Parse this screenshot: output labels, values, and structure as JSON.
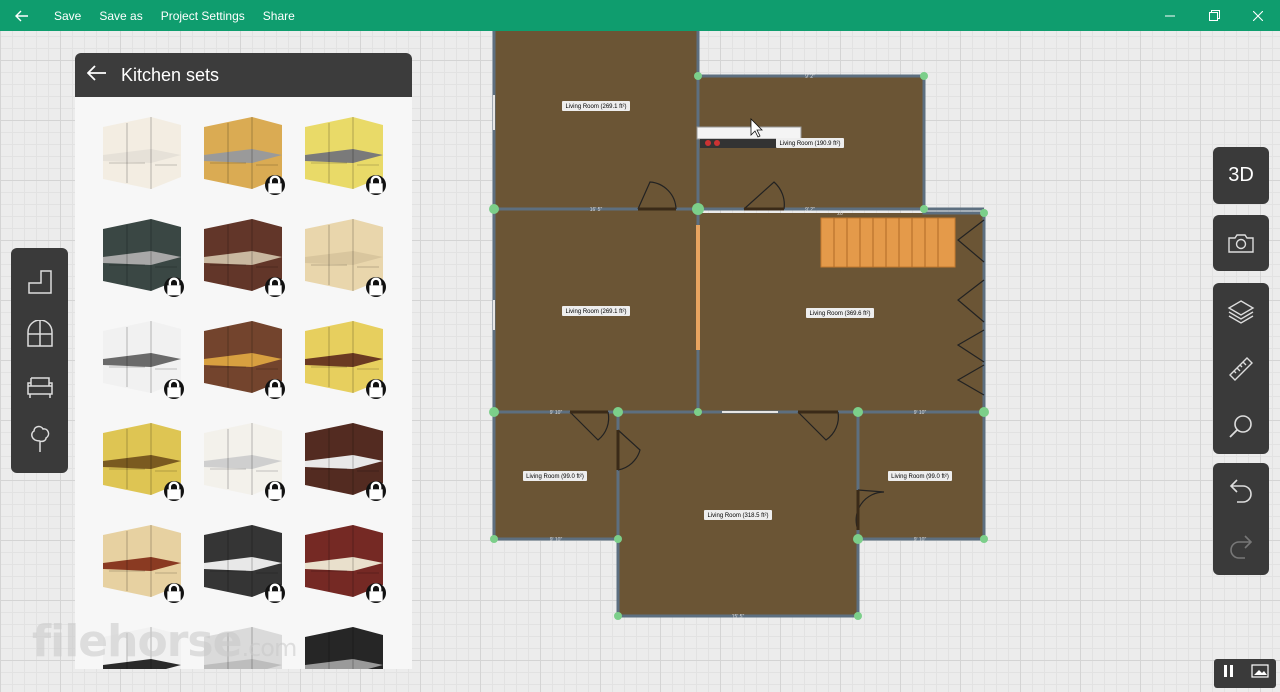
{
  "titlebar": {
    "menu": [
      "Save",
      "Save as",
      "Project Settings",
      "Share"
    ],
    "bg_color": "#0f9d6e",
    "icons": [
      "back-arrow-icon",
      "minimize-icon",
      "maximize-icon",
      "close-icon"
    ]
  },
  "catalog": {
    "title": "Kitchen sets",
    "items": [
      {
        "locked": false,
        "cabinet": "#f2ece0",
        "counter": "#e6e1d8"
      },
      {
        "locked": true,
        "cabinet": "#d8a64a",
        "counter": "#9a9a9a"
      },
      {
        "locked": true,
        "cabinet": "#e8d860",
        "counter": "#7a7a7a"
      },
      {
        "locked": true,
        "cabinet": "#2f3d3a",
        "counter": "#a8a8a8"
      },
      {
        "locked": true,
        "cabinet": "#5a2b1e",
        "counter": "#c9b8a0"
      },
      {
        "locked": true,
        "cabinet": "#e8d4a8",
        "counter": "#d9c69e"
      },
      {
        "locked": true,
        "cabinet": "#f0f0f0",
        "counter": "#6a6a6a"
      },
      {
        "locked": true,
        "cabinet": "#6b3a22",
        "counter": "#d8a040"
      },
      {
        "locked": true,
        "cabinet": "#e6cc55",
        "counter": "#6b3a22"
      },
      {
        "locked": true,
        "cabinet": "#dcc24a",
        "counter": "#7a5a20"
      },
      {
        "locked": true,
        "cabinet": "#f2f0ea",
        "counter": "#cfcfcf"
      },
      {
        "locked": true,
        "cabinet": "#4a2015",
        "counter": "#e8e8e8"
      },
      {
        "locked": true,
        "cabinet": "#e6cf9c",
        "counter": "#8a3a22"
      },
      {
        "locked": true,
        "cabinet": "#2a2a2a",
        "counter": "#e8e8e8"
      },
      {
        "locked": true,
        "cabinet": "#6e1e18",
        "counter": "#e9e0cc"
      },
      {
        "locked": false,
        "cabinet": "#f0f0f0",
        "counter": "#2a2a2a"
      },
      {
        "locked": false,
        "cabinet": "#d8d8d8",
        "counter": "#bdbdbd"
      },
      {
        "locked": false,
        "cabinet": "#1a1a1a",
        "counter": "#9a9a9a"
      }
    ]
  },
  "left_tools": [
    "wall-tool-icon",
    "window-tool-icon",
    "furniture-tool-icon",
    "plant-tool-icon"
  ],
  "right_toolbar": {
    "view_3d_label": "3D",
    "icons": [
      "camera-icon",
      "layers-icon",
      "ruler-icon",
      "search-icon",
      "undo-icon",
      "redo-icon"
    ]
  },
  "floorplan": {
    "room_color": "#6b5535",
    "wall_color": "#5d6f80",
    "node_color": "#7ccf8a",
    "rooms": [
      {
        "label": "Living Room (269.1 ft²)"
      },
      {
        "label": "Living Room (190.9 ft²)"
      },
      {
        "label": "Living Room (269.1 ft²)"
      },
      {
        "label": "Living Room (369.6 ft²)"
      },
      {
        "label": "Living Room (99.0 ft²)"
      },
      {
        "label": "Living Room (318.5 ft²)"
      },
      {
        "label": "Living Room (99.0 ft²)"
      }
    ],
    "dimensions": [
      "16' 5\"",
      "9' 2\"",
      "20",
      "9' 10\"",
      "9' 10\"",
      "9' 10\"",
      "9' 10\"",
      "15' 5\"",
      "9' 2\""
    ]
  },
  "watermark": {
    "text": "filehorse",
    "suffix": ".com"
  }
}
